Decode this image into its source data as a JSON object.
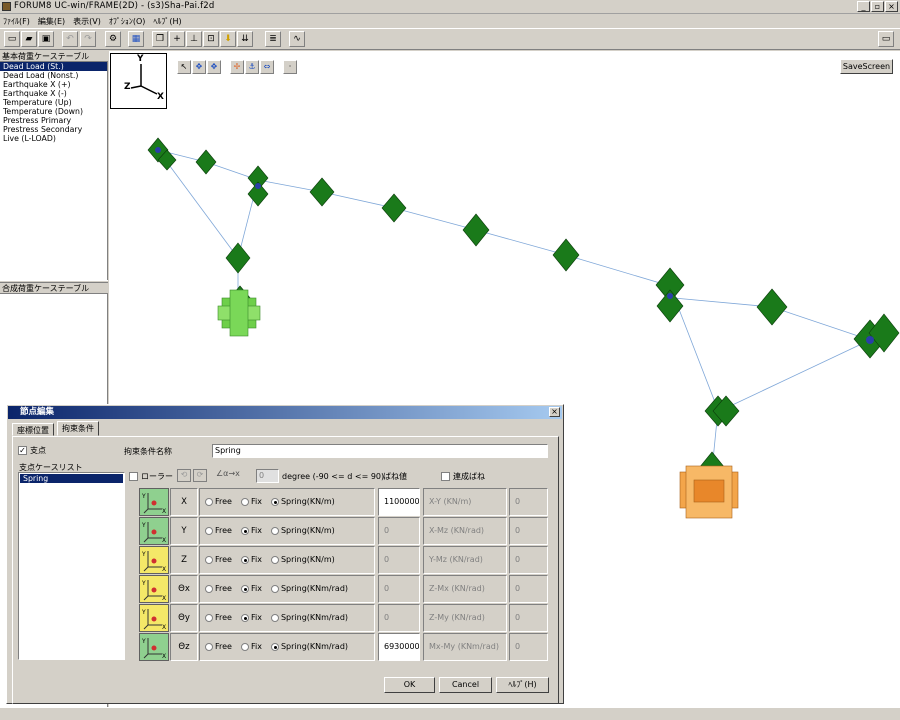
{
  "window": {
    "title": "FORUM8 UC-win/FRAME(2D) - (s3)Sha-Pai.f2d"
  },
  "menu": [
    "ﾌｧｲﾙ(F)",
    "編集(E)",
    "表示(V)",
    "ｵﾌﾟｼｮﾝ(O)",
    "ﾍﾙﾌﾟ(H)"
  ],
  "left": {
    "top_header": "基本荷重ケーステーブル",
    "load_cases": [
      "Dead Load (St.)",
      "Dead Load (Nonst.)",
      "Earthquake X (+)",
      "Earthquake X (-)",
      "Temperature (Up)",
      "Temperature (Down)",
      "Prestress Primary",
      "Prestress Secondary",
      "Live (L-LOAD)"
    ],
    "selected_index": 0,
    "bottom_header": "合成荷重ケーステーブル"
  },
  "viewer": {
    "save_label": "SaveScreen",
    "axis": {
      "y": "Y",
      "z": "Z",
      "x": "X"
    }
  },
  "dialog": {
    "title": "節点編集",
    "tabs": [
      "座標位置",
      "拘束条件"
    ],
    "active_tab": 1,
    "support_label": "支点",
    "support_checked": true,
    "support_list_label": "支点ケースリスト",
    "support_list": [
      "Spring"
    ],
    "condition_name_label": "拘束条件名称",
    "condition_name": "Spring",
    "roller_label": "ローラー",
    "degree_value": "0",
    "degree_text": "degree (-90 <= d <= 90)",
    "spring_value_label": "ばね値",
    "coupled_spring_label": "連成ばね",
    "rows": [
      {
        "dir": "X",
        "state": "spring",
        "spring_label": "Spring(KN/m)",
        "value": "1100000",
        "coupled_label": "X-Y (KN/m)",
        "coupled_value": "0",
        "icon_color": "#8fd08f"
      },
      {
        "dir": "Y",
        "state": "fix",
        "spring_label": "Spring(KN/m)",
        "value": "0",
        "coupled_label": "X-Mz (KN/rad)",
        "coupled_value": "0",
        "icon_color": "#8fd08f"
      },
      {
        "dir": "Z",
        "state": "fix",
        "spring_label": "Spring(KN/m)",
        "value": "0",
        "coupled_label": "Y-Mz (KN/rad)",
        "coupled_value": "0",
        "icon_color": "#f4e868"
      },
      {
        "dir": "Θx",
        "state": "fix",
        "spring_label": "Spring(KNm/rad)",
        "value": "0",
        "coupled_label": "Z-Mx (KN/rad)",
        "coupled_value": "0",
        "icon_color": "#f4e868"
      },
      {
        "dir": "Θy",
        "state": "fix",
        "spring_label": "Spring(KNm/rad)",
        "value": "0",
        "coupled_label": "Z-My (KN/rad)",
        "coupled_value": "0",
        "icon_color": "#f4e868"
      },
      {
        "dir": "Θz",
        "state": "spring",
        "spring_label": "Spring(KNm/rad)",
        "value": "6930000",
        "coupled_label": "Mx-My (KNm/rad)",
        "coupled_value": "0",
        "icon_color": "#8fd08f"
      }
    ],
    "free_label": "Free",
    "fix_label": "Fix",
    "ok_label": "OK",
    "cancel_label": "Cancel",
    "help_label": "ﾍﾙﾌﾟ(H)"
  }
}
